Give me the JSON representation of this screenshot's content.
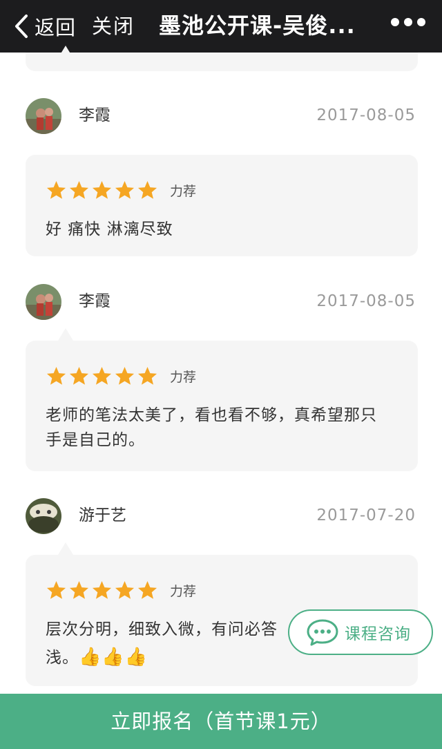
{
  "nav": {
    "back_label": "返回",
    "close_label": "关闭",
    "title": "墨池公开课-吴俊...",
    "icons": {
      "back": "chevron-left-icon",
      "more": "more-dots-icon"
    }
  },
  "reviews": [
    {
      "name": "李霞",
      "date": "2017-08-05",
      "rating": 5,
      "rating_label": "力荐",
      "comment": "好 痛快 淋漓尽致"
    },
    {
      "name": "李霞",
      "date": "2017-08-05",
      "rating": 5,
      "rating_label": "力荐",
      "comment": "老师的笔法太美了，看也看不够，真希望那只手是自己的。"
    },
    {
      "name": "游于艺",
      "date": "2017-07-20",
      "rating": 5,
      "rating_label": "力荐",
      "comment": "层次分明，细致入微，有问必答",
      "comment_line2": "浅。",
      "comment_emoji": "👍👍👍"
    }
  ],
  "consult": {
    "label": "课程咨询",
    "icon": "chat-bubble-icon"
  },
  "signup": {
    "label": "立即报名（首节课1元）"
  },
  "colors": {
    "accent": "#4caf86",
    "star": "#f5a623",
    "navbar": "#1c1c1e",
    "bubble": "#f5f5f5"
  }
}
